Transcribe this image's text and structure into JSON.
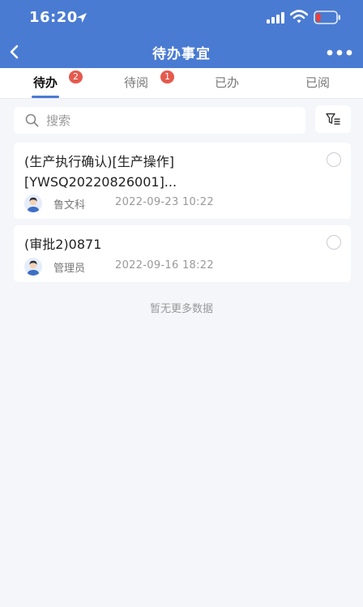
{
  "status_bar": {
    "time": "16:20"
  },
  "nav": {
    "title": "待办事宜"
  },
  "tabs": [
    {
      "label": "待办",
      "badge": "2",
      "active": true
    },
    {
      "label": "待阅",
      "badge": "1",
      "active": false
    },
    {
      "label": "已办",
      "badge": "",
      "active": false
    },
    {
      "label": "已阅",
      "badge": "",
      "active": false
    }
  ],
  "search": {
    "placeholder": "搜索",
    "value": ""
  },
  "items": [
    {
      "title": "(生产执行确认)[生产操作][YWSQ20220826001]...",
      "title_line1": "(生产执行确认)[生产操作]",
      "title_line2": "[YWSQ20220826001]...",
      "user": "鲁文科",
      "time": "2022-09-23 10:22"
    },
    {
      "title": "(审批2)0871",
      "user": "管理员",
      "time": "2022-09-16 18:22"
    }
  ],
  "footer": {
    "no_more": "暂无更多数据"
  },
  "colors": {
    "primary": "#4a7bd2",
    "badge": "#e55a4e",
    "background": "#f4f6fa"
  }
}
